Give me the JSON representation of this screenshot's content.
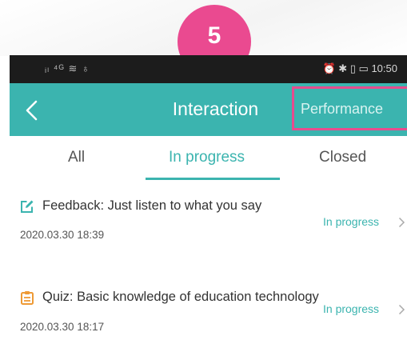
{
  "step_badge": "5",
  "status_bar": {
    "left_icons": "ᵢₗ ⁴ᴳ ≋ ♁",
    "right_icons": "⏰ ✱ ▯ ▭",
    "time": "10:50"
  },
  "header": {
    "title": "Interaction",
    "performance_label": "Performance"
  },
  "tabs": [
    {
      "label": "All",
      "active": false
    },
    {
      "label": "In progress",
      "active": true
    },
    {
      "label": "Closed",
      "active": false
    }
  ],
  "items": [
    {
      "icon": "edit-icon",
      "title": "Feedback: Just listen to what you say",
      "time": "2020.03.30 18:39",
      "status": "In progress"
    },
    {
      "icon": "clipboard-icon",
      "title": "Quiz: Basic knowledge of education technology",
      "time": "2020.03.30 18:17",
      "status": "In progress"
    }
  ],
  "colors": {
    "accent": "#3bb4af",
    "highlight": "#e74c8e",
    "badge": "#ea4a90",
    "quiz_icon": "#ee9a35"
  }
}
